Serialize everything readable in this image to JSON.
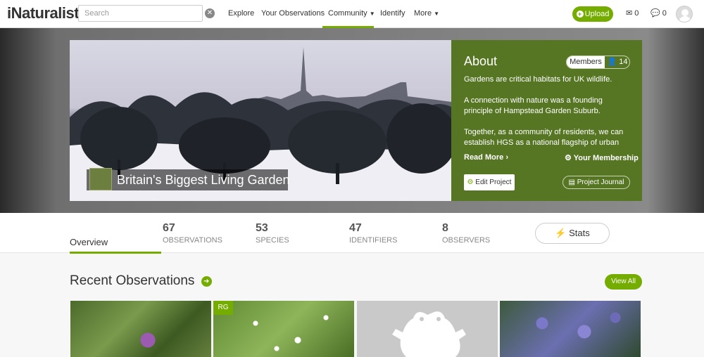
{
  "nav": {
    "logo": "iNaturalist",
    "search_placeholder": "Search",
    "links": [
      "Explore",
      "Your Observations",
      "Community",
      "Identify",
      "More"
    ],
    "upload_label": "Upload",
    "messages_count": "0",
    "notifications_count": "0"
  },
  "hero": {
    "title": "Britain's Biggest Living Garden"
  },
  "about": {
    "title": "About",
    "members_label": "Members",
    "members_count": "14",
    "paragraphs": [
      "Gardens are critical habitats for UK wildlife.",
      "A connection with nature was a founding principle of Hampstead Garden Suburb.",
      "Together, as a community of residents, we can establish HGS as a national flagship of urban"
    ],
    "read_more": "Read More",
    "membership": "Your Membership",
    "edit_project": "Edit Project",
    "project_journal": "Project Journal"
  },
  "stats": {
    "overview": "Overview",
    "items": [
      {
        "num": "67",
        "label": "OBSERVATIONS"
      },
      {
        "num": "53",
        "label": "SPECIES"
      },
      {
        "num": "47",
        "label": "IDENTIFIERS"
      },
      {
        "num": "8",
        "label": "OBSERVERS"
      }
    ],
    "stats_button": "Stats"
  },
  "recent": {
    "title": "Recent Observations",
    "view_all": "View All",
    "badge": "RG"
  },
  "colors": {
    "brand_green": "#74ac00",
    "about_green": "#567624"
  }
}
